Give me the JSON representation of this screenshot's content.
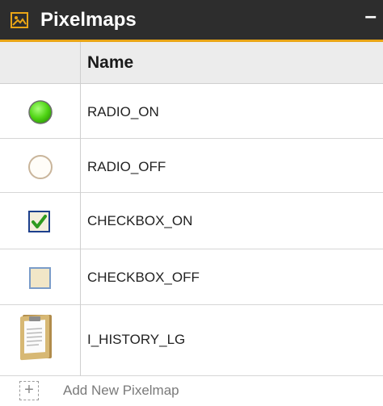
{
  "panel": {
    "title": "Pixelmaps",
    "minimize_glyph": "–",
    "icon": "image-icon",
    "accent_color": "#e9a516"
  },
  "table": {
    "column_name": "Name",
    "rows": [
      {
        "label": "RADIO_ON",
        "icon": "radio-on-icon",
        "color": "#4fd414"
      },
      {
        "label": "RADIO_OFF",
        "icon": "radio-off-icon"
      },
      {
        "label": "CHECKBOX_ON",
        "icon": "checkbox-on-icon",
        "color": "#2e9a1e"
      },
      {
        "label": "CHECKBOX_OFF",
        "icon": "checkbox-off-icon"
      },
      {
        "label": "I_HISTORY_LG",
        "icon": "clipboard-history-icon"
      }
    ]
  },
  "footer": {
    "add_label": "Add New Pixelmap",
    "add_icon_glyph": "+",
    "add_icon": "add-icon"
  }
}
